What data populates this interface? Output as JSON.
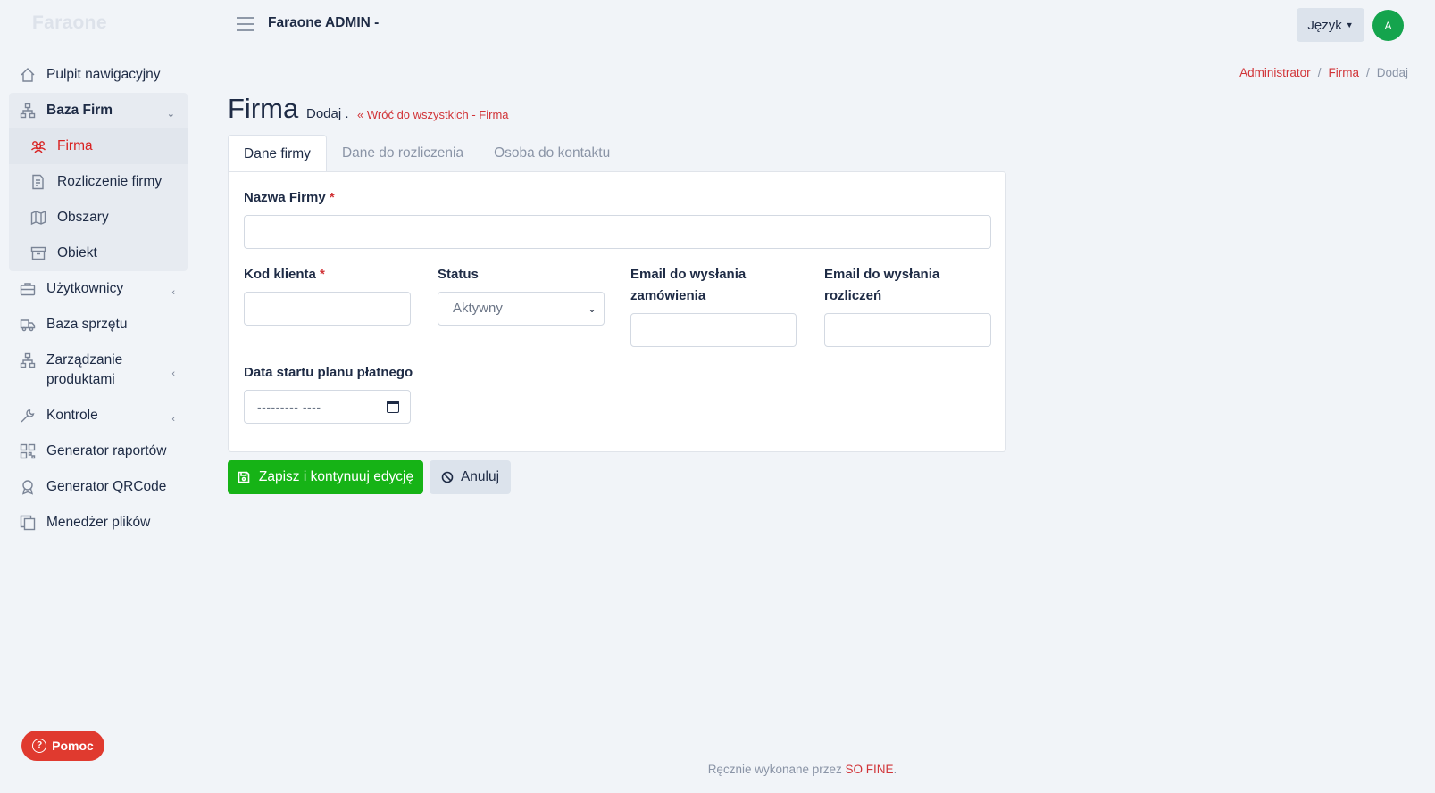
{
  "brand": "Faraone",
  "topbar": {
    "title": "Faraone ADMIN -",
    "language_label": "Język",
    "avatar_initial": "A"
  },
  "sidebar": {
    "items": [
      {
        "label": "Pulpit nawigacyjny",
        "icon": "home-icon"
      },
      {
        "label": "Baza Firm",
        "icon": "sitemap-icon",
        "expanded": true,
        "children": [
          {
            "label": "Firma",
            "icon": "users-icon",
            "active": true
          },
          {
            "label": "Rozliczenie firmy",
            "icon": "invoice-icon"
          },
          {
            "label": "Obszary",
            "icon": "map-icon"
          },
          {
            "label": "Obiekt",
            "icon": "archive-icon"
          }
        ]
      },
      {
        "label": "Użytkownicy",
        "icon": "briefcase-icon"
      },
      {
        "label": "Baza sprzętu",
        "icon": "truck-icon"
      },
      {
        "label": "Zarządzanie produktami",
        "icon": "sitemap-icon"
      },
      {
        "label": "Kontrole",
        "icon": "wrench-icon"
      },
      {
        "label": "Generator raportów",
        "icon": "qrcode-icon"
      },
      {
        "label": "Generator QRCode",
        "icon": "award-icon"
      },
      {
        "label": "Menedżer plików",
        "icon": "copy-icon"
      }
    ],
    "help_label": "Pomoc"
  },
  "breadcrumb": {
    "items": [
      "Administrator",
      "Firma",
      "Dodaj"
    ],
    "separator": "/"
  },
  "page": {
    "title": "Firma",
    "subtitle": "Dodaj .",
    "back_link": "Wróć do wszystkich - Firma"
  },
  "tabs": [
    "Dane firmy",
    "Dane do rozliczenia",
    "Osoba do kontaktu"
  ],
  "form": {
    "company_name_label": "Nazwa Firmy",
    "client_code_label": "Kod klienta",
    "required_mark": "*",
    "status_label": "Status",
    "status_value": "Aktywny",
    "order_email_label": "Email do wysłania zamówienia",
    "billing_email_label": "Email do wysłania rozliczeń",
    "plan_start_label": "Data startu planu płatnego",
    "plan_start_placeholder": "--------- ----"
  },
  "actions": {
    "save_label": "Zapisz i kontynuuj edycję",
    "cancel_label": "Anuluj"
  },
  "footer": {
    "text": "Ręcznie wykonane przez",
    "link": "SO FINE",
    "suffix": "."
  },
  "colors": {
    "accent": "#d13438",
    "success": "#16b316",
    "avatar": "#14a44d",
    "help": "#e03a2f"
  }
}
